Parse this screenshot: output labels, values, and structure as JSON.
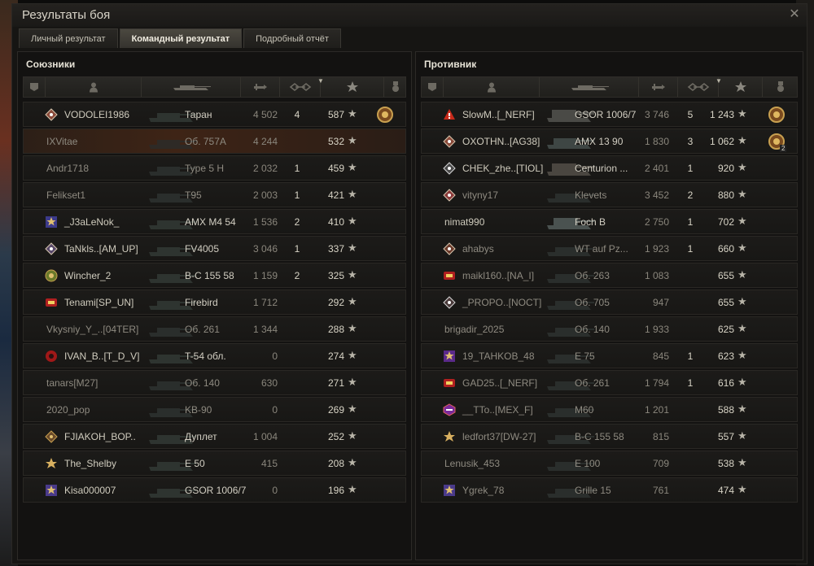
{
  "window": {
    "title": "Результаты боя"
  },
  "tabs": [
    {
      "label": "Личный результат",
      "active": false
    },
    {
      "label": "Командный результат",
      "active": true
    },
    {
      "label": "Подробный отчёт",
      "active": false
    }
  ],
  "allies": {
    "title": "Союзники",
    "rows": [
      {
        "badge": "clan-diamond-icon",
        "name": "VODOLEI1986",
        "vehicle": "Таран",
        "damage": "4 502",
        "kills": "4",
        "xp": "587",
        "medal": "mastery-medal-icon",
        "medal_count": "",
        "own": false,
        "dead": false
      },
      {
        "badge": "",
        "name": "IXVitae",
        "vehicle": "Об. 757А",
        "damage": "4 244",
        "kills": "",
        "xp": "532",
        "medal": "",
        "medal_count": "",
        "own": true,
        "dead": true
      },
      {
        "badge": "",
        "name": "Andr1718",
        "vehicle": "Type 5 H",
        "damage": "2 032",
        "kills": "1",
        "xp": "459",
        "medal": "",
        "medal_count": "",
        "own": false,
        "dead": true
      },
      {
        "badge": "",
        "name": "Felikset1",
        "vehicle": "T95",
        "damage": "2 003",
        "kills": "1",
        "xp": "421",
        "medal": "",
        "medal_count": "",
        "own": false,
        "dead": true
      },
      {
        "badge": "clan-star-icon",
        "name": "_J3aLeNok_",
        "vehicle": "AMX M4 54",
        "damage": "1 536",
        "kills": "2",
        "xp": "410",
        "medal": "",
        "medal_count": "",
        "own": false,
        "dead": false
      },
      {
        "badge": "clan-diamond-icon",
        "name": "TaNkls..[AM_UP]",
        "vehicle": "FV4005",
        "damage": "3 046",
        "kills": "1",
        "xp": "337",
        "medal": "",
        "medal_count": "",
        "own": false,
        "dead": false
      },
      {
        "badge": "clan-shield-icon",
        "name": "Wincher_2",
        "vehicle": "B-C 155 58",
        "damage": "1 159",
        "kills": "2",
        "xp": "325",
        "medal": "",
        "medal_count": "",
        "own": false,
        "dead": false
      },
      {
        "badge": "clan-red-icon",
        "name": "Tenami[SP_UN]",
        "vehicle": "Firebird",
        "damage": "1 712",
        "kills": "",
        "xp": "292",
        "medal": "",
        "medal_count": "",
        "own": false,
        "dead": false
      },
      {
        "badge": "",
        "name": "Vkysniy_Y_..[04TER]",
        "vehicle": "Об. 261",
        "damage": "1 344",
        "kills": "",
        "xp": "288",
        "medal": "",
        "medal_count": "",
        "own": false,
        "dead": true
      },
      {
        "badge": "clan-ring-icon",
        "name": "IVAN_B..[T_D_V]",
        "vehicle": "T-54 обл.",
        "damage": "0",
        "kills": "",
        "xp": "274",
        "medal": "",
        "medal_count": "",
        "own": false,
        "dead": false
      },
      {
        "badge": "",
        "name": "tanars[M27]",
        "vehicle": "Об. 140",
        "damage": "630",
        "kills": "",
        "xp": "271",
        "medal": "",
        "medal_count": "",
        "own": false,
        "dead": true
      },
      {
        "badge": "",
        "name": "2020_pop",
        "vehicle": "KB-90",
        "damage": "0",
        "kills": "",
        "xp": "269",
        "medal": "",
        "medal_count": "",
        "own": false,
        "dead": true
      },
      {
        "badge": "clan-diamond-icon",
        "name": "FJIAKOH_BOP..",
        "vehicle": "Дуплет",
        "damage": "1 004",
        "kills": "",
        "xp": "252",
        "medal": "",
        "medal_count": "",
        "own": false,
        "dead": false
      },
      {
        "badge": "clan-star-icon",
        "name": "The_Shelby",
        "vehicle": "E 50",
        "damage": "415",
        "kills": "",
        "xp": "208",
        "medal": "",
        "medal_count": "",
        "own": false,
        "dead": false
      },
      {
        "badge": "clan-star-icon",
        "name": "Kisa000007",
        "vehicle": "GSOR 1006/7",
        "damage": "0",
        "kills": "",
        "xp": "196",
        "medal": "",
        "medal_count": "",
        "own": false,
        "dead": false
      }
    ]
  },
  "enemies": {
    "title": "Противник",
    "rows": [
      {
        "badge": "clan-warning-icon",
        "name": "SlowM..[_NERF]",
        "vehicle": "GSOR 1006/7",
        "damage": "3 746",
        "kills": "5",
        "xp": "1 243",
        "medal": "mastery-medal-icon",
        "medal_count": "",
        "dead": false
      },
      {
        "badge": "clan-diamond-icon",
        "name": "OXOTHN..[AG38]",
        "vehicle": "AMX 13 90",
        "damage": "1 830",
        "kills": "3",
        "xp": "1 062",
        "medal": "mastery-medal-icon",
        "medal_count": "2",
        "dead": false
      },
      {
        "badge": "clan-diamond-icon",
        "name": "CHEK_zhe..[TIOL]",
        "vehicle": "Centurion ...",
        "damage": "2 401",
        "kills": "1",
        "xp": "920",
        "medal": "",
        "medal_count": "",
        "dead": false
      },
      {
        "badge": "clan-diamond-icon",
        "name": "vityny17",
        "vehicle": "Klevets",
        "damage": "3 452",
        "kills": "2",
        "xp": "880",
        "medal": "",
        "medal_count": "",
        "dead": true
      },
      {
        "badge": "",
        "name": "nimat990",
        "vehicle": "Foch B",
        "damage": "2 750",
        "kills": "1",
        "xp": "702",
        "medal": "",
        "medal_count": "",
        "dead": false
      },
      {
        "badge": "clan-diamond-icon",
        "name": "ahabys",
        "vehicle": "WT auf Pz...",
        "damage": "1 923",
        "kills": "1",
        "xp": "660",
        "medal": "",
        "medal_count": "",
        "dead": true
      },
      {
        "badge": "clan-red-icon",
        "name": "maikl160..[NA_I]",
        "vehicle": "Об. 263",
        "damage": "1 083",
        "kills": "",
        "xp": "655",
        "medal": "",
        "medal_count": "",
        "dead": true
      },
      {
        "badge": "clan-diamond-icon",
        "name": "_PROPO..[NOCT]",
        "vehicle": "Об. 705",
        "damage": "947",
        "kills": "",
        "xp": "655",
        "medal": "",
        "medal_count": "",
        "dead": true
      },
      {
        "badge": "",
        "name": "brigadir_2025",
        "vehicle": "Об. 140",
        "damage": "1 933",
        "kills": "",
        "xp": "625",
        "medal": "",
        "medal_count": "",
        "dead": true
      },
      {
        "badge": "clan-star-icon",
        "name": "19_TAHKOB_48",
        "vehicle": "E 75",
        "damage": "845",
        "kills": "1",
        "xp": "623",
        "medal": "",
        "medal_count": "",
        "dead": true
      },
      {
        "badge": "clan-red-icon",
        "name": "GAD25..[_NERF]",
        "vehicle": "Об. 261",
        "damage": "1 794",
        "kills": "1",
        "xp": "616",
        "medal": "",
        "medal_count": "",
        "dead": true
      },
      {
        "badge": "clan-nerf-icon",
        "name": "__TTo..[MEX_F]",
        "vehicle": "M60",
        "damage": "1 201",
        "kills": "",
        "xp": "588",
        "medal": "",
        "medal_count": "",
        "dead": true
      },
      {
        "badge": "clan-star-icon",
        "name": "ledfort37[DW-27]",
        "vehicle": "B-C 155 58",
        "damage": "815",
        "kills": "",
        "xp": "557",
        "medal": "",
        "medal_count": "",
        "dead": true
      },
      {
        "badge": "",
        "name": "Lenusik_453",
        "vehicle": "E 100",
        "damage": "709",
        "kills": "",
        "xp": "538",
        "medal": "",
        "medal_count": "",
        "dead": true
      },
      {
        "badge": "clan-star-icon",
        "name": "Ygrek_78",
        "vehicle": "Grille 15",
        "damage": "761",
        "kills": "",
        "xp": "474",
        "medal": "",
        "medal_count": "",
        "dead": true
      }
    ]
  },
  "colors": {
    "accent_gold": "#c8a050",
    "own_row": "#3e2416",
    "text_alive": "#d2cec2",
    "text_dead": "#8e8a80"
  }
}
